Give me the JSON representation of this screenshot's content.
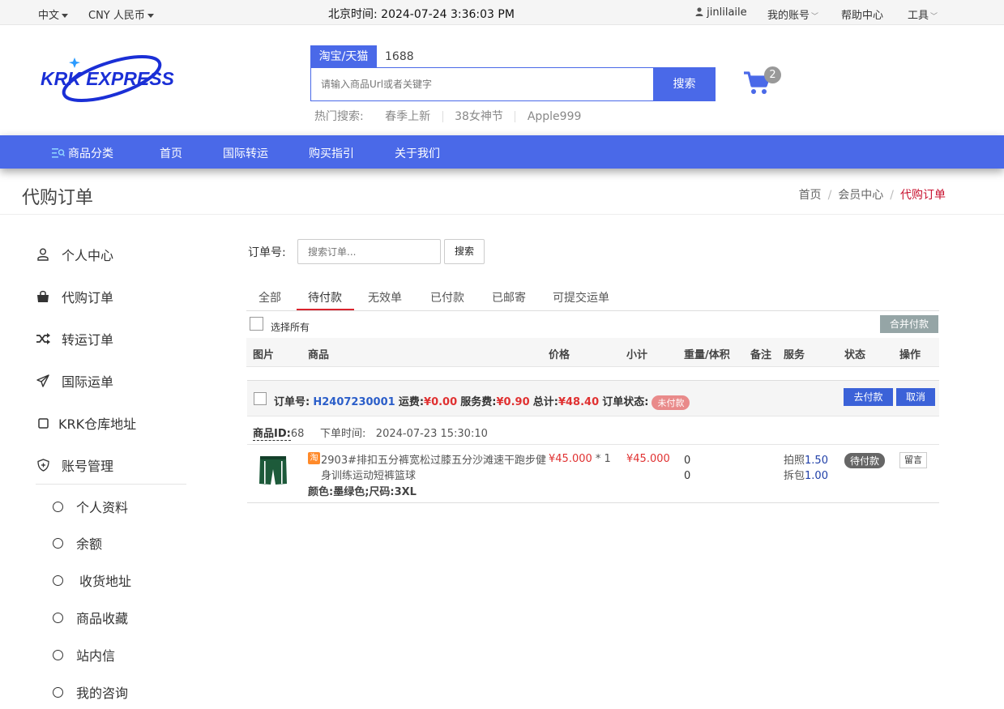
{
  "topbar": {
    "language": "中文",
    "currency": "CNY 人民币",
    "clock_label": "北京时间:",
    "clock_value": "2024-07-24 3:36:03 PM",
    "username": "jinlilaile",
    "my_account": "我的账号",
    "help_center": "帮助中心",
    "tools": "工具"
  },
  "header": {
    "logo_text": "KRK EXPRESS",
    "search_tab_active": "淘宝/天猫",
    "search_tab_other": "1688",
    "search_placeholder": "请输入商品Url或者关键字",
    "search_button": "搜索",
    "hot_label": "热门搜索:",
    "hot_terms": [
      "春季上新",
      "38女神节",
      "Apple999"
    ],
    "cart_count": "2",
    "brand_color": "#4a69e8"
  },
  "nav": {
    "items": [
      "商品分类",
      "首页",
      "国际转运",
      "购买指引",
      "关于我们"
    ]
  },
  "page": {
    "title": "代购订单",
    "breadcrumb": [
      "首页",
      "会员中心",
      "代购订单"
    ],
    "breadcrumb_sep": "/"
  },
  "sidebar": {
    "items": [
      {
        "label": "个人中心",
        "icon": "user-icon"
      },
      {
        "label": "代购订单",
        "icon": "shopping-bag-icon"
      },
      {
        "label": "转运订单",
        "icon": "shuffle-icon"
      },
      {
        "label": "国际运单",
        "icon": "paper-plane-icon"
      },
      {
        "label": "KRK仓库地址",
        "icon": "square-icon"
      },
      {
        "label": "账号管理",
        "icon": "shield-icon"
      }
    ],
    "sub_items": [
      "个人资料",
      "余额",
      "收货地址",
      "商品收藏",
      "站内信",
      "我的咨询"
    ]
  },
  "orders": {
    "search_label": "订单号:",
    "search_placeholder": "搜索订单...",
    "search_button": "搜索",
    "tabs": [
      "全部",
      "待付款",
      "无效单",
      "已付款",
      "已邮寄",
      "可提交运单"
    ],
    "active_tab": "待付款",
    "select_all": "选择所有",
    "merge_pay": "合并付款",
    "columns": [
      "图片",
      "商品",
      "价格",
      "小计",
      "重量/体积",
      "备注",
      "服务",
      "状态",
      "操作"
    ],
    "order": {
      "number_label": "订单号:",
      "number": "H2407230001",
      "shipping_label": "运费:",
      "shipping": "¥0.00",
      "service_fee_label": "服务费:",
      "service_fee": "¥0.90",
      "total_label": "总计:",
      "total": "¥48.40",
      "status_label": "订单状态:",
      "status": "未付款",
      "pay_button": "去付款",
      "cancel_button": "取消",
      "product_id_label": "商品ID:",
      "product_id": "68",
      "time_label": "下单时间:",
      "time": "2024-07-23 15:30:10",
      "item": {
        "source_tag": "淘",
        "name_line1": "2903#排扣五分裤宽松过膝五分沙滩速干跑步健",
        "name_line2": "身训练运动短裤篮球",
        "spec": "颜色:墨绿色;尺码:3XL",
        "price": "¥45.000",
        "qty": " * 1",
        "subtotal": "¥45.000",
        "weight": "0",
        "volume": "0",
        "service_photo_label": "拍照",
        "service_photo_value": "1.50",
        "service_unpack_label": "拆包",
        "service_unpack_value": "1.00",
        "status": "待付款",
        "message_button": "留言"
      }
    }
  }
}
